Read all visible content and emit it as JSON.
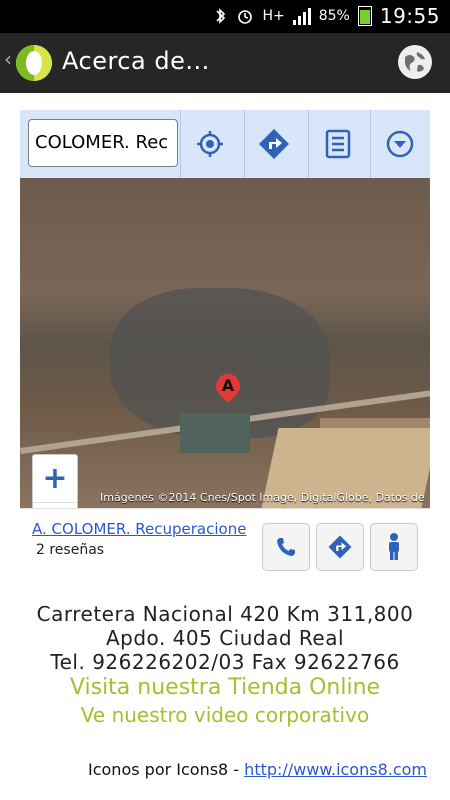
{
  "status": {
    "battery": "85%",
    "time": "19:55",
    "network": "H+"
  },
  "header": {
    "title": "Acerca de..."
  },
  "map": {
    "search_value": "COLOMER. Rec",
    "attribution": "Imágenes ©2014 Cnes/Spot Image, DigitalGlobe, Datos de",
    "pin_label": "A",
    "zoom_in": "+",
    "zoom_out": "−",
    "place_name": "A. COLOMER. Recuperacione",
    "reviews": "2 reseñas"
  },
  "footer": {
    "address_line1": "Carretera Nacional 420 Km 311,800",
    "address_line2": "Apdo. 405 Ciudad Real",
    "phone_line": "Tel. 926226202/03 Fax 92622766",
    "online_store": "Visita nuestra Tienda Online",
    "video_link": "Ve nuestro video corporativo",
    "credits_prefix": "Iconos por Icons8 - ",
    "credits_link": "http://www.icons8.com"
  },
  "icons": {
    "toolbar": [
      "location-icon",
      "directions-icon",
      "list-icon",
      "more-icon"
    ],
    "place_actions": [
      "phone-icon",
      "directions-icon",
      "person-icon"
    ]
  },
  "colors": {
    "action_bar": "#262626",
    "accent_blue": "#2f63b7",
    "link_blue": "#2a58d0",
    "brand_green": "#a9bd2d"
  }
}
